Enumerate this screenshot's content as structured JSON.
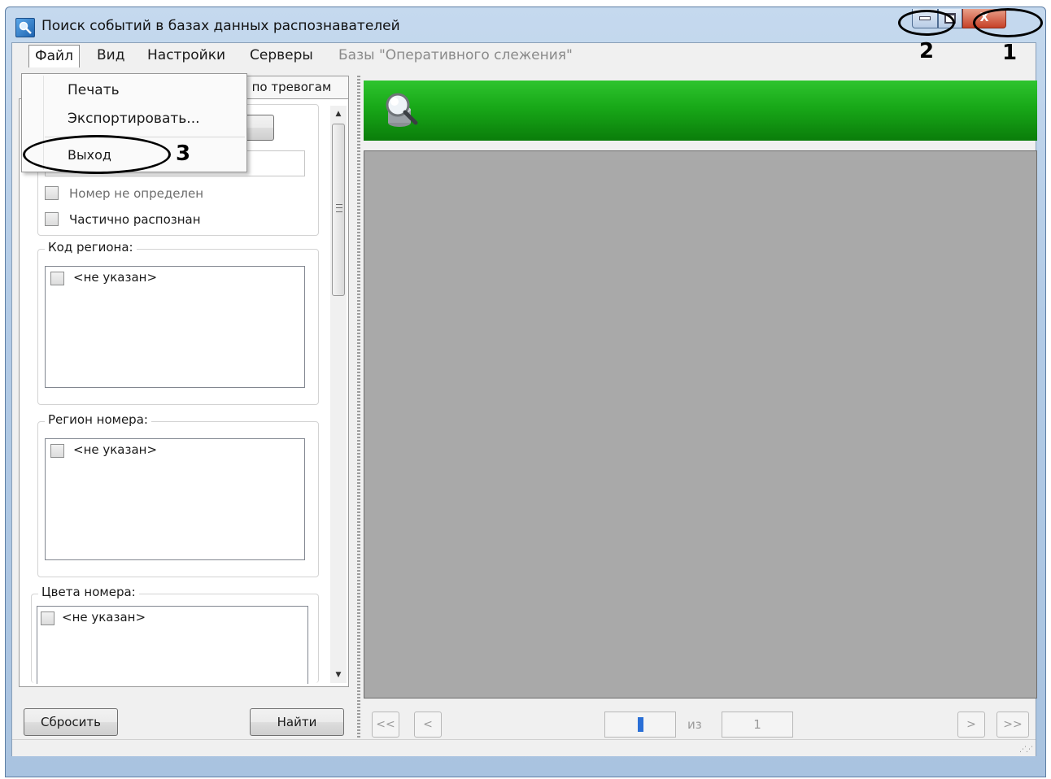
{
  "window": {
    "title": "Поиск событий в базах данных распознавателей",
    "close_glyph": "X"
  },
  "menubar": {
    "file": "Файл",
    "view": "Вид",
    "settings": "Настройки",
    "servers": "Серверы",
    "databases": "Базы \"Оперативного слежения\""
  },
  "file_menu": {
    "print": "Печать",
    "export": "Экспортировать...",
    "exit": "Выход"
  },
  "left_panel": {
    "tab_label": "ь по тревогам",
    "checkbox_number_undefined": "Номер не определен",
    "checkbox_partially_recognized": "Частично распознан",
    "region_code": {
      "title": "Код региона:",
      "items": [
        "<не указан>"
      ]
    },
    "number_region": {
      "title": "Регион номера:",
      "items": [
        "<не указан>"
      ]
    },
    "number_colors": {
      "title": "Цвета номера:",
      "items": [
        "<не указан>"
      ]
    },
    "reset_button": "Сбросить",
    "find_button": "Найти"
  },
  "pagination": {
    "first": "<<",
    "prev": "<",
    "of": "из",
    "total_pages": "1",
    "next": ">",
    "last": ">>"
  },
  "annotations": [
    "1",
    "2",
    "3"
  ],
  "colors": {
    "header_green": "#18a818",
    "results_gray": "#a9a9a9",
    "close_red": "#c64128"
  }
}
